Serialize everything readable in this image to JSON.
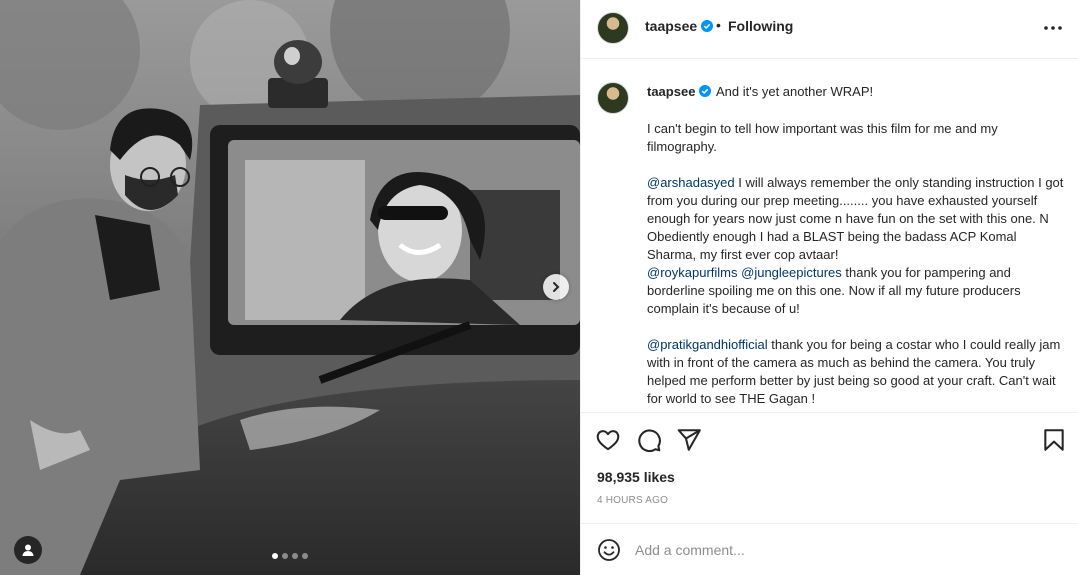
{
  "media": {
    "carousel_dots": [
      true,
      false,
      false,
      false
    ],
    "next_icon": "chevron-right-icon",
    "tag_icon": "user-tag-icon"
  },
  "header": {
    "username": "taapsee",
    "separator": "•",
    "follow_status": "Following",
    "more_icon": "more-horizontal-icon"
  },
  "caption": {
    "username": "taapsee",
    "first_line": "And it's yet another WRAP!",
    "paragraph_1": "I can't begin to tell how important was this film for me and my filmography.",
    "para2_mention": "@arshadasyed",
    "para2_text": " I will always remember the only standing instruction I got from you during our prep meeting........ you have exhausted yourself enough for years now just come n have fun on the set with this one. N Obediently enough I had a BLAST being the badass ACP Komal Sharma, my first ever cop avtaar!",
    "para2_mention_b": "@roykapurfilms",
    "para2_mention_c": "@jungleepictures",
    "para2_text_b": " thank you for pampering and borderline spoiling me on this one. Now if all my future producers complain it's because of u!",
    "para3_mention": "@pratikgandhiofficial",
    "para3_text": " thank you for being a costar who I could really jam with in front of the camera as much as behind the camera. You truly helped me perform better by just being so good at your craft. Can't wait for world to see THE Gagan !"
  },
  "actions": {
    "like_icon": "heart-icon",
    "comment_icon": "comment-icon",
    "share_icon": "send-icon",
    "save_icon": "bookmark-icon",
    "likes": "98,935 likes",
    "timestamp": "4 HOURS AGO"
  },
  "comment": {
    "emoji_icon": "emoji-icon",
    "placeholder": "Add a comment..."
  },
  "colors": {
    "link": "#00376b",
    "verified": "#0095f6",
    "muted": "#8e8e8e"
  }
}
